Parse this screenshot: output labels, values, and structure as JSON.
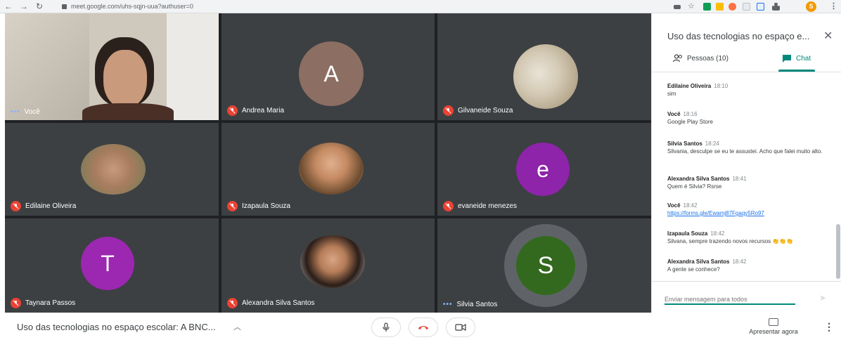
{
  "browser": {
    "url": "meet.google.com/uhs-sqjn-uua?authuser=0",
    "profile_initial": "S"
  },
  "tiles": [
    {
      "name": "Você",
      "type": "video",
      "muted": false
    },
    {
      "name": "Andrea Maria",
      "type": "letter",
      "letter": "A",
      "color": "#8d6e63",
      "muted": true
    },
    {
      "name": "Gilvaneide Souza",
      "type": "photo",
      "muted": true
    },
    {
      "name": "Edilaine Oliveira",
      "type": "photo",
      "muted": true
    },
    {
      "name": "Izapaula Souza",
      "type": "photo",
      "muted": true
    },
    {
      "name": "evaneide menezes",
      "type": "letter",
      "letter": "e",
      "color": "#8e24aa",
      "muted": true
    },
    {
      "name": "Taynara Passos",
      "type": "letter",
      "letter": "T",
      "color": "#9c27b0",
      "muted": true
    },
    {
      "name": "Alexandra Silva Santos",
      "type": "photo",
      "muted": true
    },
    {
      "name": "Silvia Santos",
      "type": "letter",
      "letter": "S",
      "color": "#33691e",
      "muted": false,
      "speaking": true
    }
  ],
  "panel": {
    "title": "Uso das tecnologias no espaço e...",
    "people_tab": "Pessoas (10)",
    "chat_tab": "Chat",
    "compose_placeholder": "Enviar mensagem para todos"
  },
  "messages": [
    {
      "sender": "Edilaine Oliveira",
      "time": "18:10",
      "text": "sim"
    },
    {
      "sender": "Você",
      "time": "18:16",
      "text": "Google Play Store"
    },
    {
      "sender": "Silvia Santos",
      "time": "18:24",
      "text": "Silvania, desculpe se eu te assustei. Acho que falei muito alto."
    },
    {
      "sender": "Alexandra Silva Santos",
      "time": "18:41",
      "text": "Quem é Silvia? Rsrse"
    },
    {
      "sender": "Você",
      "time": "18:42",
      "text": "https://forms.gle/Ewamj87Fgaqy5Ro97",
      "is_link": true
    },
    {
      "sender": "Izapaula Souza",
      "time": "18:42",
      "text": "Silvana, sempre trazendo novos recursos 👏👏👏"
    },
    {
      "sender": "Alexandra Silva Santos",
      "time": "18:42",
      "text": "A gente se conhece?"
    }
  ],
  "bottom": {
    "meeting_title": "Uso das tecnologias no espaço escolar: A BNC...",
    "present_label": "Apresentar agora"
  },
  "colors": {
    "accent": "#00897b",
    "mic_off": "#ea4335",
    "grid_bg": "#202124",
    "tile_bg": "#3c4043"
  }
}
